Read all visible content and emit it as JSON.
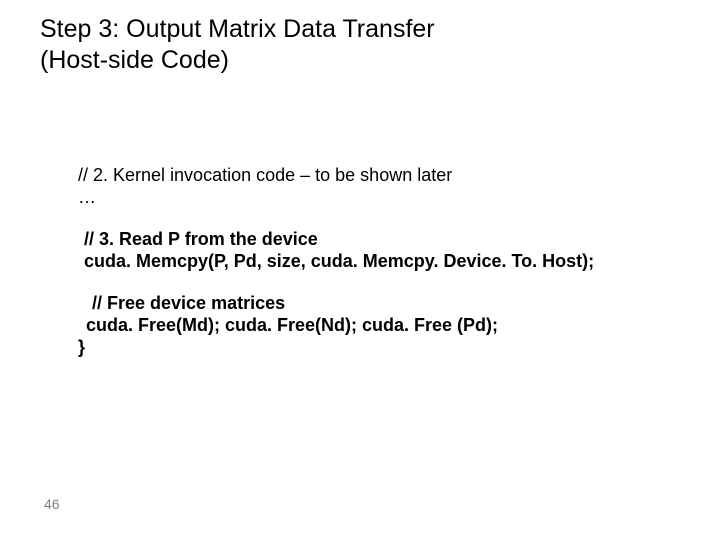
{
  "title": {
    "line1": "Step 3: Output Matrix Data Transfer",
    "line2": "(Host-side Code)"
  },
  "code": {
    "block1": {
      "line1": "// 2. Kernel invocation code – to be shown later",
      "line2": "…"
    },
    "block2": {
      "line1": "// 3. Read P from the device",
      "line2": "cuda. Memcpy(P, Pd, size, cuda. Memcpy. Device. To. Host);"
    },
    "block3": {
      "line1": " // Free device matrices",
      "line2": "cuda. Free(Md); cuda. Free(Nd); cuda. Free (Pd);",
      "line3": "}"
    }
  },
  "page_number": "46"
}
